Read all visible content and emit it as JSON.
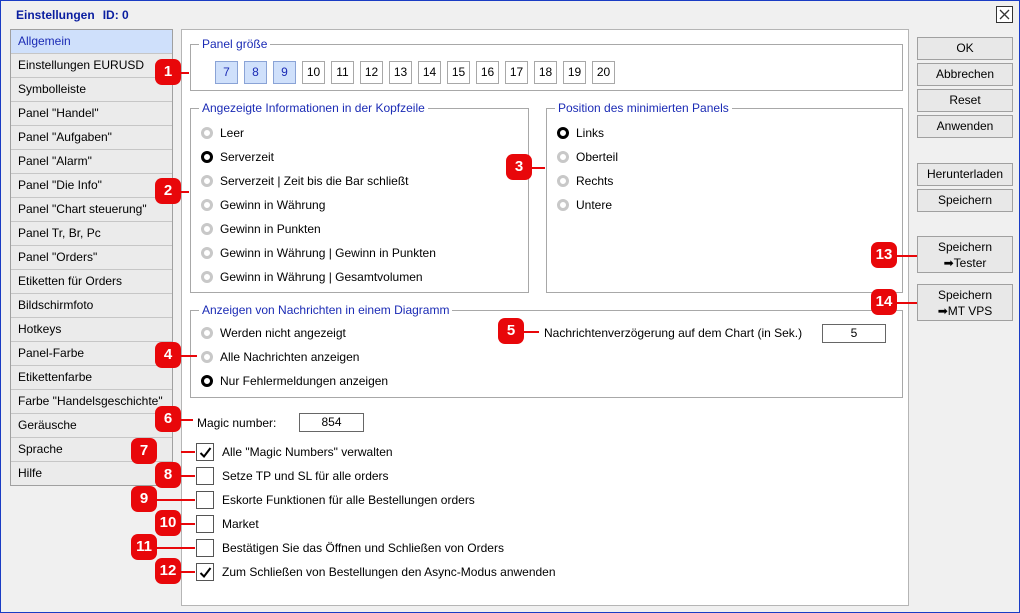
{
  "window": {
    "title": "Einstellungen",
    "id_label": "ID: 0"
  },
  "sidebar": {
    "items": [
      {
        "label": "Allgemein",
        "active": true
      },
      {
        "label": "Einstellungen EURUSD"
      },
      {
        "label": "Symbolleiste"
      },
      {
        "label": "Panel \"Handel\""
      },
      {
        "label": "Panel \"Aufgaben\""
      },
      {
        "label": "Panel \"Alarm\""
      },
      {
        "label": "Panel \"Die Info\""
      },
      {
        "label": "Panel \"Chart steuerung\""
      },
      {
        "label": "Panel Tr, Br, Pc"
      },
      {
        "label": "Panel \"Orders\""
      },
      {
        "label": "Etiketten für Orders"
      },
      {
        "label": "Bildschirmfoto"
      },
      {
        "label": "Hotkeys"
      },
      {
        "label": "Panel-Farbe"
      },
      {
        "label": "Etikettenfarbe"
      },
      {
        "label": "Farbe \"Handelsgeschichte\""
      },
      {
        "label": "Geräusche"
      },
      {
        "label": "Sprache"
      },
      {
        "label": "Hilfe"
      }
    ]
  },
  "panel_size": {
    "legend": "Panel größe",
    "options": [
      "7",
      "8",
      "9",
      "10",
      "11",
      "12",
      "13",
      "14",
      "15",
      "16",
      "17",
      "18",
      "19",
      "20"
    ],
    "selected": [
      "7",
      "8",
      "9"
    ]
  },
  "header_info": {
    "legend": "Angezeigte Informationen in der Kopfzeile",
    "options": [
      "Leer",
      "Serverzeit",
      "Serverzeit | Zeit bis die Bar schließt",
      "Gewinn in Währung",
      "Gewinn in Punkten",
      "Gewinn in Währung | Gewinn in Punkten",
      "Gewinn in Währung | Gesamtvolumen"
    ],
    "selected": "Serverzeit"
  },
  "min_panel_position": {
    "legend": "Position des minimierten Panels",
    "options": [
      "Links",
      "Oberteil",
      "Rechts",
      "Untere"
    ],
    "selected": "Links"
  },
  "chart_messages": {
    "legend": "Anzeigen von Nachrichten in einem Diagramm",
    "options": [
      "Werden nicht angezeigt",
      "Alle Nachrichten anzeigen",
      "Nur Fehlermeldungen anzeigen"
    ],
    "selected": "Nur Fehlermeldungen anzeigen",
    "delay_label": "Nachrichtenverzögerung auf dem Chart (in Sek.)",
    "delay_value": "5"
  },
  "magic": {
    "label": "Magic number:",
    "value": "854"
  },
  "checkboxes": [
    {
      "label": "Alle \"Magic Numbers\" verwalten",
      "checked": true
    },
    {
      "label": "Setze TP und SL für alle orders",
      "checked": false
    },
    {
      "label": "Eskorte Funktionen für alle Bestellungen orders",
      "checked": false
    },
    {
      "label": "Market",
      "checked": false
    },
    {
      "label": "Bestätigen Sie das Öffnen und Schließen von Orders",
      "checked": false
    },
    {
      "label": "Zum Schließen von Bestellungen den Async-Modus anwenden",
      "checked": true
    }
  ],
  "buttons": {
    "ok": "OK",
    "cancel": "Abbrechen",
    "reset": "Reset",
    "apply": "Anwenden",
    "download": "Herunterladen",
    "save": "Speichern",
    "save_tester_line1": "Speichern",
    "save_tester_line2": "➡Tester",
    "save_vps_line1": "Speichern",
    "save_vps_line2": "➡MT VPS"
  },
  "badges": [
    "1",
    "2",
    "3",
    "4",
    "5",
    "6",
    "7",
    "8",
    "9",
    "10",
    "11",
    "12",
    "13",
    "14"
  ],
  "colors": {
    "accent": "#1b2bb5",
    "badge": "#e8070a",
    "selected_bg": "#cfe0fb",
    "window_border": "#1a3cc4"
  },
  "icons": {
    "close": "close-icon",
    "checkmark": "checkmark-icon"
  }
}
